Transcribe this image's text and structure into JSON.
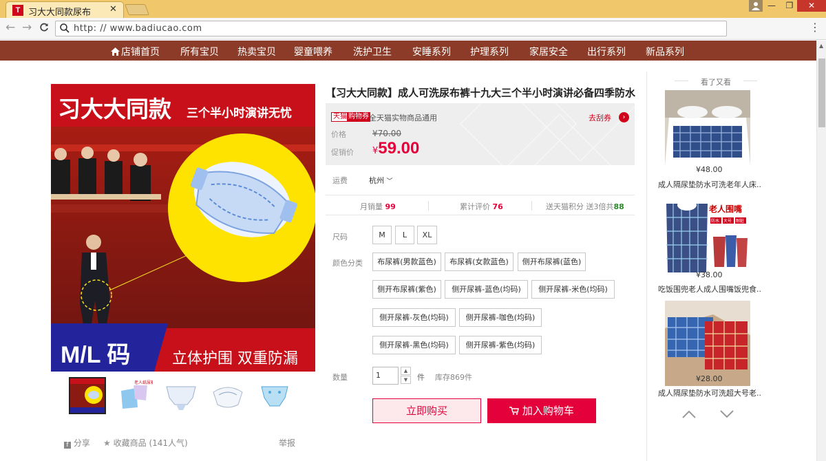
{
  "browser": {
    "tab_title": "习大大同款尿布",
    "tab_favicon": "T",
    "url_scheme": "http:",
    "url_rest": "// www.badiucao.com",
    "icons": [
      "back-arrow-icon",
      "forward-arrow-icon",
      "reload-icon",
      "search-icon",
      "menu-dots-icon",
      "close-icon",
      "minimize-icon",
      "maximize-icon",
      "profile-icon"
    ]
  },
  "shop_nav": {
    "items": [
      "店铺首页",
      "所有宝贝",
      "热卖宝贝",
      "婴童喂养",
      "洗护卫生",
      "安睡系列",
      "护理系列",
      "家居安全",
      "出行系列",
      "新品系列"
    ]
  },
  "main_image": {
    "headline": "习大大同款",
    "subheadline": "三个半小时演讲无忧",
    "size_text": "M/L 码",
    "bottom_text": "立体护围 双重防漏"
  },
  "product": {
    "title": "【习大大同款】成人可洗尿布裤十九大三个半小时演讲必备四季防水",
    "badge_tmall": "天猫",
    "badge_coupon": "购物券",
    "coupon_text": "全天猫实物商品通用",
    "coupon_link": "去刮券",
    "price_label": "价格",
    "price_original": "¥70.00",
    "promo_label": "促销价",
    "promo_currency": "¥",
    "promo_price": "59.00",
    "shipping_label": "运费",
    "shipping_value": "杭州",
    "stats": {
      "monthly_sales_label": "月销量",
      "monthly_sales": "99",
      "reviews_label": "累计评价",
      "reviews": "76",
      "points_label": "送天猫积分 送3倍共",
      "points": "88"
    },
    "size_label": "尺码",
    "sizes": [
      "M",
      "L",
      "XL"
    ],
    "color_label": "颜色分类",
    "colors": [
      "布尿裤(男款蓝色)",
      "布尿裤(女款蓝色)",
      "侧开布尿裤(蓝色)",
      "侧开布尿裤(紫色)",
      "侧开尿裤-蓝色(均码)",
      "侧开尿裤-米色(均码)",
      "侧开尿裤-灰色(均码)",
      "侧开尿裤-咖色(均码)",
      "侧开尿裤-黑色(均码)",
      "侧开尿裤-紫色(均码)"
    ],
    "quantity_label": "数量",
    "quantity": "1",
    "quantity_unit": "件",
    "stock": "库存869件",
    "buy_now": "立即购买",
    "add_cart": "加入购物车"
  },
  "share": {
    "share_label": "分享",
    "favorite_label": "收藏商品",
    "popularity": "(141人气)",
    "report_label": "举报"
  },
  "recommendations": {
    "header": "看了又看",
    "items": [
      {
        "price": "¥48.00",
        "title": "成人隔尿垫防水可洗老年人床..."
      },
      {
        "price": "¥38.00",
        "title": "吃饭围兜老人成人围嘴饭兜食..."
      },
      {
        "price": "¥28.00",
        "title": "成人隔尿垫防水可洗超大号老..."
      }
    ],
    "bib_label": "老人围嘴",
    "bib_tags": [
      "防水",
      "大号",
      "耐脏"
    ]
  },
  "colors": {
    "shop_nav_bg": "#8b3b27",
    "accent_red": "#e4003a",
    "tmall_red": "#d0021b",
    "titlebar": "#f0c76a"
  }
}
